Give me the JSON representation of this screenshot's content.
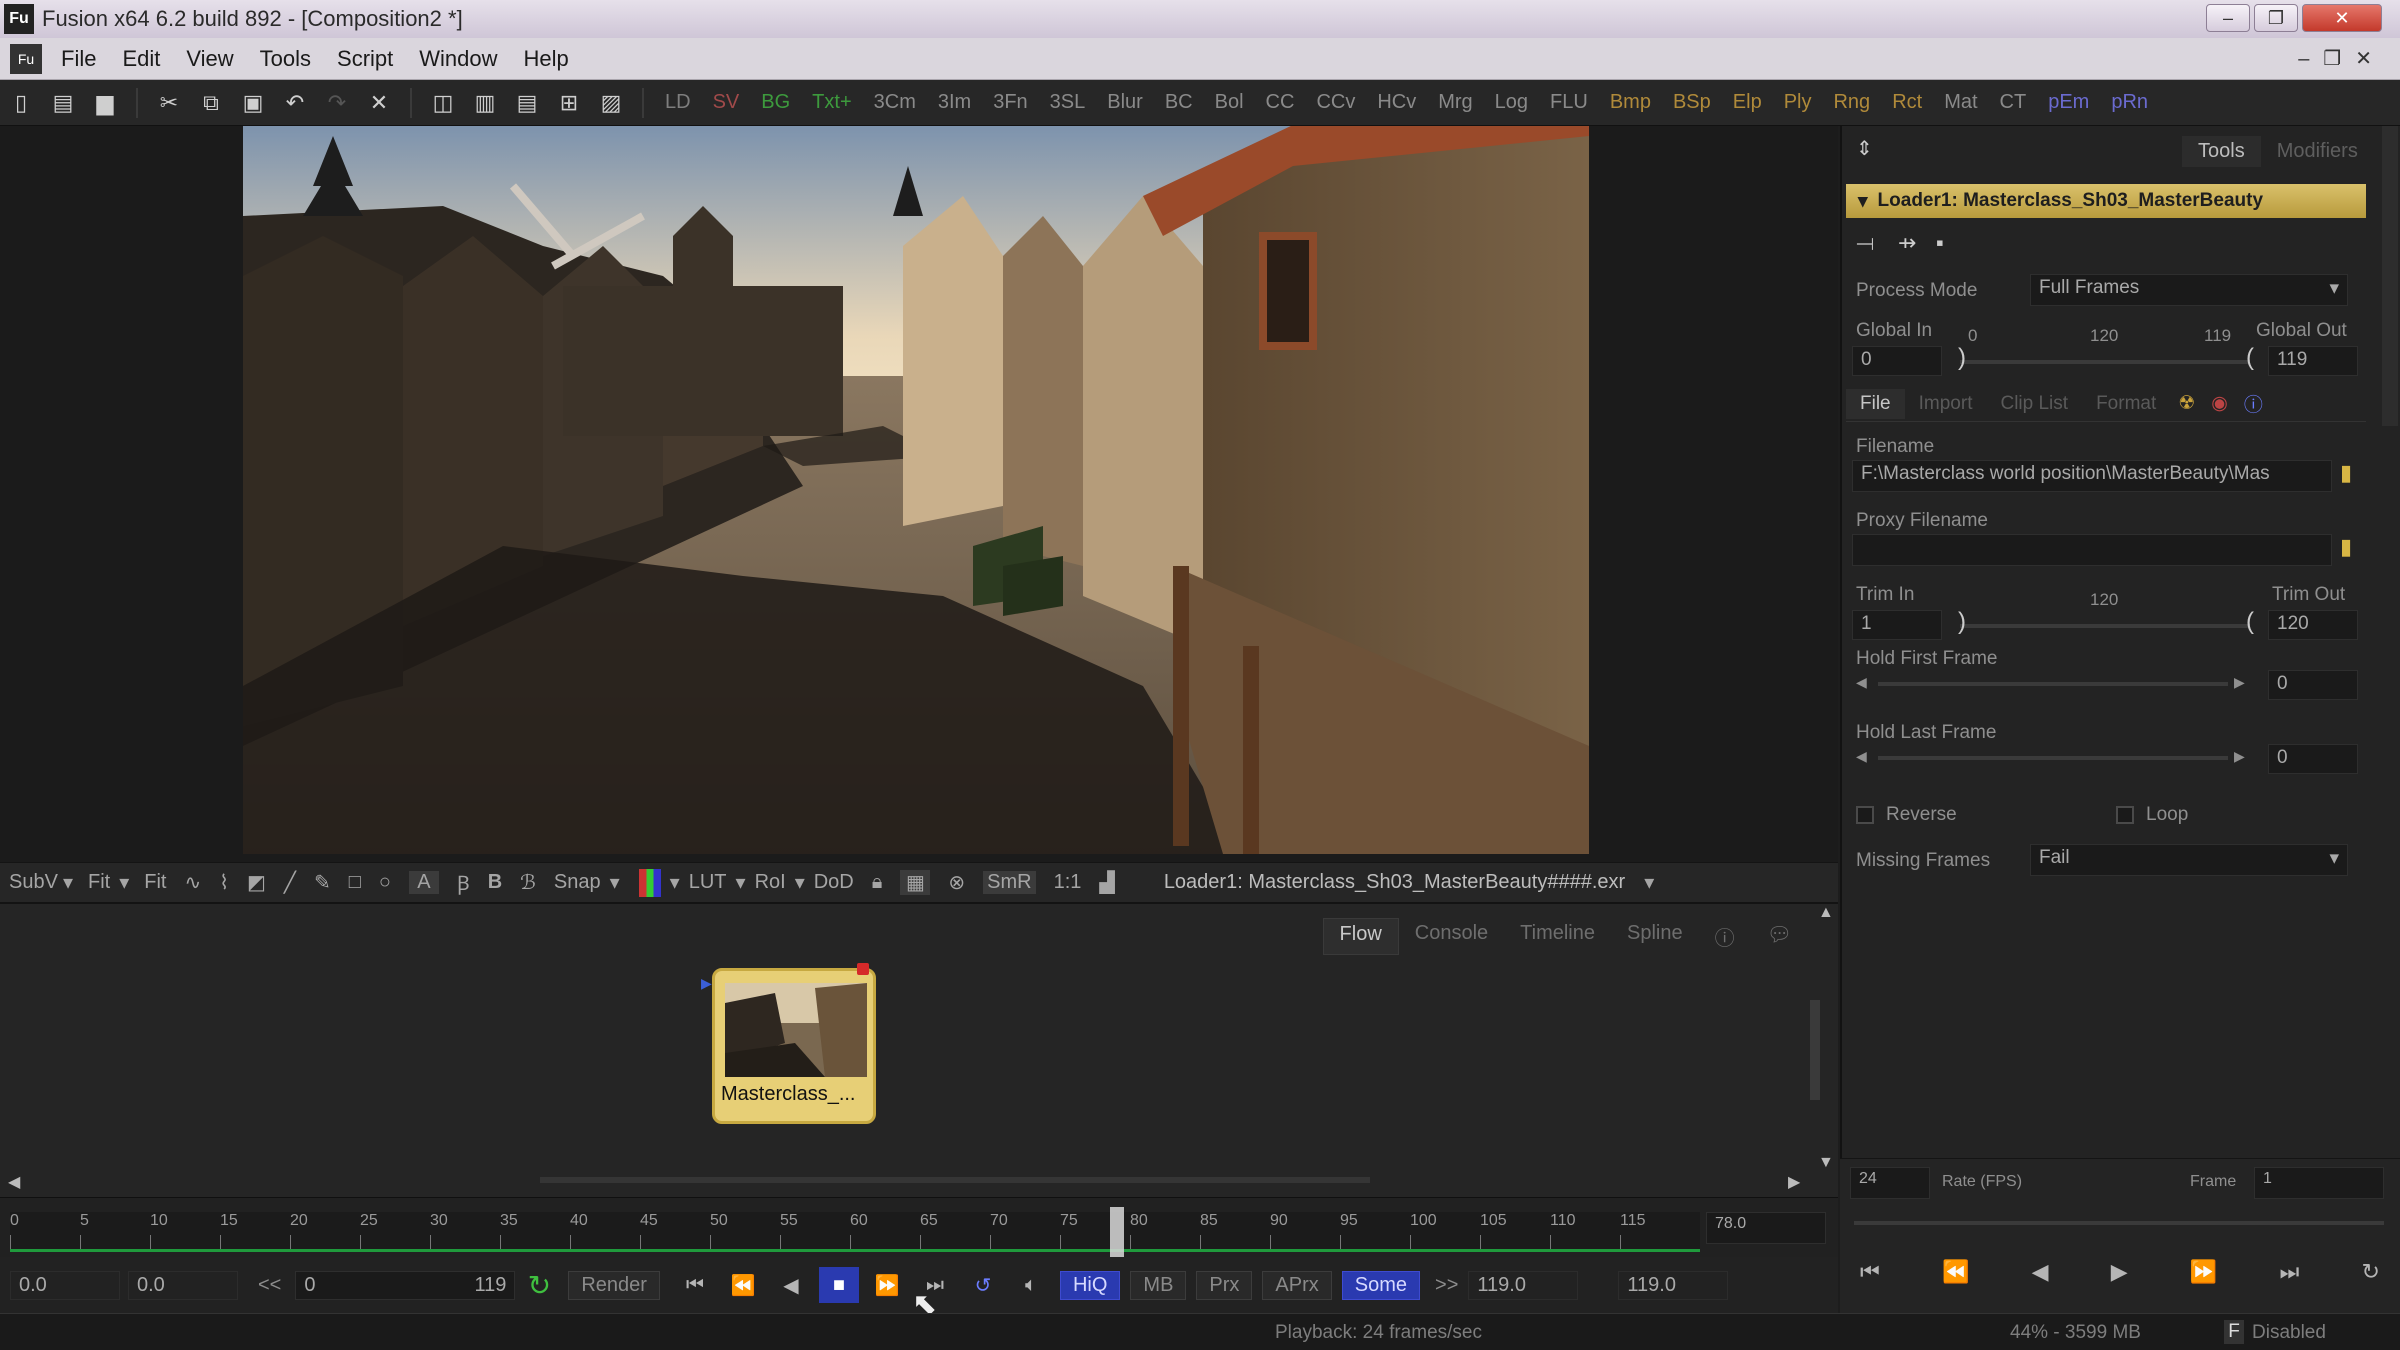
{
  "window": {
    "title": "Fusion x64 6.2 build 892 - [Composition2 *]",
    "controls": [
      "–",
      "❐",
      "✕"
    ]
  },
  "menu": [
    "File",
    "Edit",
    "View",
    "Tools",
    "Script",
    "Window",
    "Help"
  ],
  "toolbar": {
    "tools": [
      "LD",
      "SV",
      "BG",
      "Txt+",
      "3Cm",
      "3Im",
      "3Fn",
      "3SL",
      "Blur",
      "BC",
      "Bol",
      "CC",
      "CCv",
      "HCv",
      "Mrg",
      "Log",
      "FLU",
      "Bmp",
      "BSp",
      "Elp",
      "Ply",
      "Rng",
      "Rct",
      "Mat",
      "CT",
      "pEm",
      "pRn"
    ],
    "tool_colors": [
      "#7e7e7e",
      "#a04a4a",
      "#3d9a3d",
      "#3d9a3d",
      "#8a8a8a",
      "#8a8a8a",
      "#8a8a8a",
      "#8a8a8a",
      "#8a8a8a",
      "#8a8a8a",
      "#8a8a8a",
      "#8a8a8a",
      "#8a8a8a",
      "#8a8a8a",
      "#8a8a8a",
      "#8a8a8a",
      "#8a8a8a",
      "#b08a3a",
      "#b08a3a",
      "#b08a3a",
      "#b08a3a",
      "#b08a3a",
      "#b08a3a",
      "#8a8a8a",
      "#8a8a8a",
      "#6b6bd0",
      "#6b6bd0"
    ]
  },
  "viewbar": {
    "subv": "SubV",
    "fit1": "Fit",
    "fit2": "Fit",
    "snap": "Snap",
    "lut": "LUT",
    "roi": "RoI",
    "dod": "DoD",
    "smr": "SmR",
    "one": "1:1",
    "loader_path": "Loader1: Masterclass_Sh03_MasterBeauty####.exr"
  },
  "flow": {
    "tabs": [
      "Flow",
      "Console",
      "Timeline",
      "Spline"
    ],
    "node_label": "Masterclass_..."
  },
  "timeline": {
    "ticks": [
      "0",
      "5",
      "10",
      "15",
      "20",
      "25",
      "30",
      "35",
      "40",
      "45",
      "50",
      "55",
      "60",
      "65",
      "70",
      "75",
      "80",
      "85",
      "90",
      "95",
      "100",
      "105",
      "110",
      "115"
    ],
    "current": "78.0",
    "marker": "78"
  },
  "transport": {
    "start": "0.0",
    "render_start": "0.0",
    "range_start": "0",
    "range_end": "119",
    "render": "Render",
    "hiq": "HiQ",
    "mb": "MB",
    "prx": "Prx",
    "aprx": "APrx",
    "some": "Some",
    "end": "119.0",
    "render_end": "119.0",
    "prev": "<<",
    "next": ">>"
  },
  "status": {
    "playback": "Playback: 24 frames/sec",
    "memory": "44% - 3599 MB",
    "disabled": "Disabled",
    "f": "F"
  },
  "panel": {
    "tabs": [
      "Tools",
      "Modifiers"
    ],
    "loader_title": "Loader1: Masterclass_Sh03_MasterBeauty",
    "process_mode_label": "Process Mode",
    "process_mode": "Full Frames",
    "global_in_label": "Global In",
    "global_out_label": "Global Out",
    "global_in": "0",
    "global_out": "119",
    "g_tick0": "0",
    "g_tick_mid": "120",
    "g_tick_end": "119",
    "subtabs": [
      "File",
      "Import",
      "Clip List",
      "Format"
    ],
    "filename_label": "Filename",
    "filename": "F:\\Masterclass world position\\MasterBeauty\\Mas",
    "proxy_label": "Proxy Filename",
    "trim_in_label": "Trim In",
    "trim_out_label": "Trim Out",
    "trim_in": "1",
    "trim_out": "120",
    "trim_mid": "120",
    "hold_first_label": "Hold First Frame",
    "hold_first": "0",
    "hold_last_label": "Hold Last Frame",
    "hold_last": "0",
    "reverse": "Reverse",
    "loop": "Loop",
    "missing_label": "Missing Frames",
    "missing": "Fail"
  },
  "playback_panel": {
    "fps": "24",
    "rate_label": "Rate (FPS)",
    "frame_label": "Frame",
    "frame": "1"
  }
}
